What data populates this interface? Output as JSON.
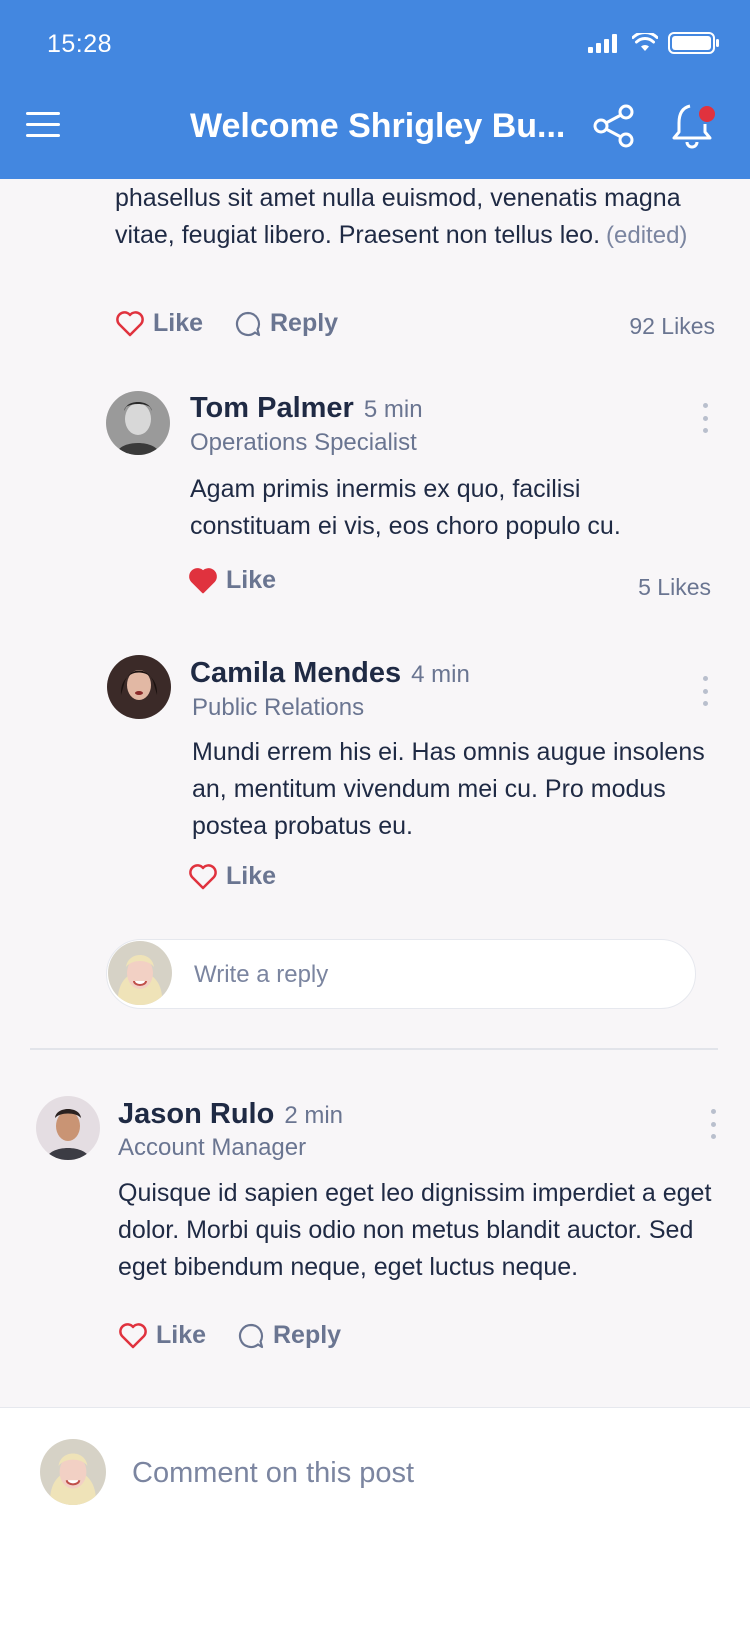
{
  "status_bar": {
    "time": "15:28"
  },
  "header": {
    "title": "Welcome Shrigley Bu..."
  },
  "post": {
    "text": "phasellus sit amet nulla euismod, venenatis magna vitae, feugiat libero. Praesent non tellus leo.",
    "edited_label": "(edited)",
    "like_label": "Like",
    "reply_label": "Reply",
    "likes_count": "92 Likes"
  },
  "replies": [
    {
      "name": "Tom Palmer",
      "time": "5 min",
      "role": "Operations Specialist",
      "text": "Agam primis inermis ex quo, facilisi constituam ei vis, eos choro populo cu.",
      "like_label": "Like",
      "liked": true,
      "likes_count": "5 Likes"
    },
    {
      "name": "Camila Mendes",
      "time": "4 min",
      "role": "Public Relations",
      "text": "Mundi errem his ei. Has omnis augue insolens an, mentitum vivendum mei cu. Pro modus postea probatus eu.",
      "like_label": "Like",
      "liked": false
    }
  ],
  "reply_box": {
    "placeholder": "Write a reply"
  },
  "comment": {
    "name": "Jason Rulo",
    "time": "2 min",
    "role": "Account Manager",
    "text": "Quisque id sapien eget leo dignissim imperdiet a eget dolor. Morbi quis odio non metus blandit auctor. Sed eget bibendum neque, eget luctus neque.",
    "like_label": "Like",
    "reply_label": "Reply"
  },
  "comment_bar": {
    "placeholder": "Comment on this post"
  },
  "colors": {
    "header": "#4387e0",
    "accent_red": "#e0323e",
    "text_primary": "#1f2a44",
    "text_secondary": "#6a7591"
  },
  "icons": [
    "menu-icon",
    "share-icon",
    "bell-icon",
    "heart-icon",
    "reply-bubble-icon",
    "more-vertical-icon",
    "signal-icon",
    "wifi-icon",
    "battery-icon"
  ]
}
